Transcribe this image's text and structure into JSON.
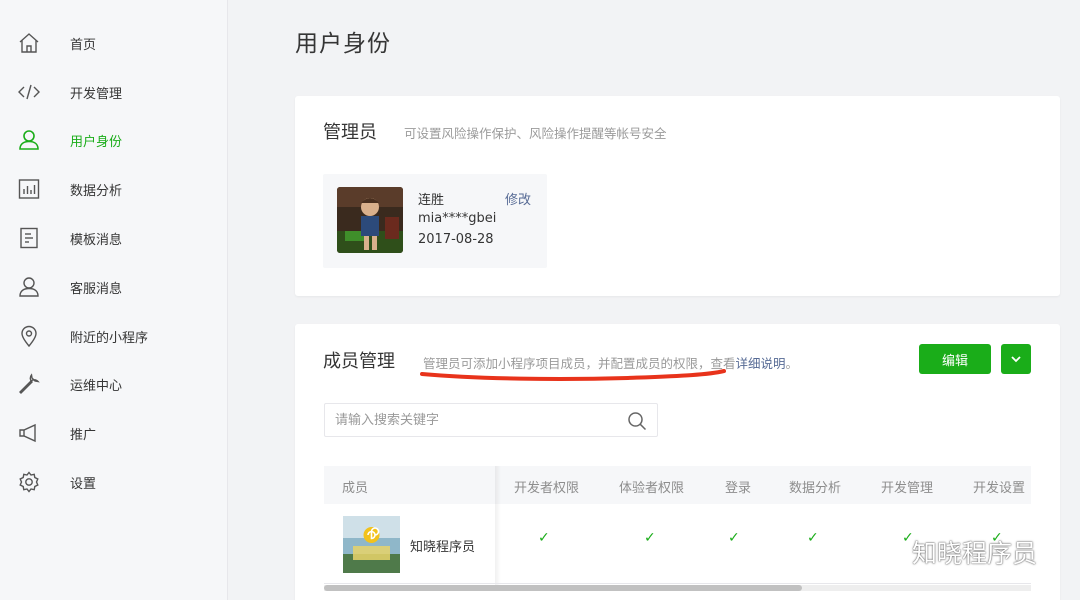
{
  "sidebar": {
    "items": [
      {
        "label": "首页",
        "icon": "home-icon"
      },
      {
        "label": "开发管理",
        "icon": "code-icon"
      },
      {
        "label": "用户身份",
        "icon": "user-icon",
        "active": true
      },
      {
        "label": "数据分析",
        "icon": "bar-chart-icon"
      },
      {
        "label": "模板消息",
        "icon": "document-icon"
      },
      {
        "label": "客服消息",
        "icon": "customer-service-icon"
      },
      {
        "label": "附近的小程序",
        "icon": "location-pin-icon"
      },
      {
        "label": "运维中心",
        "icon": "wrench-icon"
      },
      {
        "label": "推广",
        "icon": "megaphone-icon"
      },
      {
        "label": "设置",
        "icon": "gear-icon"
      }
    ],
    "active_color": "#1aad19"
  },
  "page": {
    "title": "用户身份"
  },
  "admin": {
    "title": "管理员",
    "description": "可设置风险操作保护、风险操作提醒等帐号安全",
    "name": "连胜",
    "account": "mia****gbei",
    "date": "2017-08-28",
    "edit_label": "修改"
  },
  "members": {
    "title": "成员管理",
    "description": "管理员可添加小程序项目成员，并配置成员的权限，查看",
    "link_text": "详细说明",
    "link_suffix": "。",
    "edit_button": "编辑",
    "search_placeholder": "请输入搜索关键字",
    "columns": [
      "成员",
      "开发者权限",
      "体验者权限",
      "登录",
      "数据分析",
      "开发管理",
      "开发设置"
    ],
    "rows": [
      {
        "name": "知晓程序员",
        "avatar_caption": "知晓程序员",
        "permissions": [
          "✓",
          "✓",
          "✓",
          "✓",
          "✓",
          "✓"
        ]
      }
    ]
  },
  "watermark": {
    "text": "知晓程序员"
  },
  "colors": {
    "accent": "#1aad19",
    "link": "#576b95",
    "annotation": "#e8331b"
  }
}
